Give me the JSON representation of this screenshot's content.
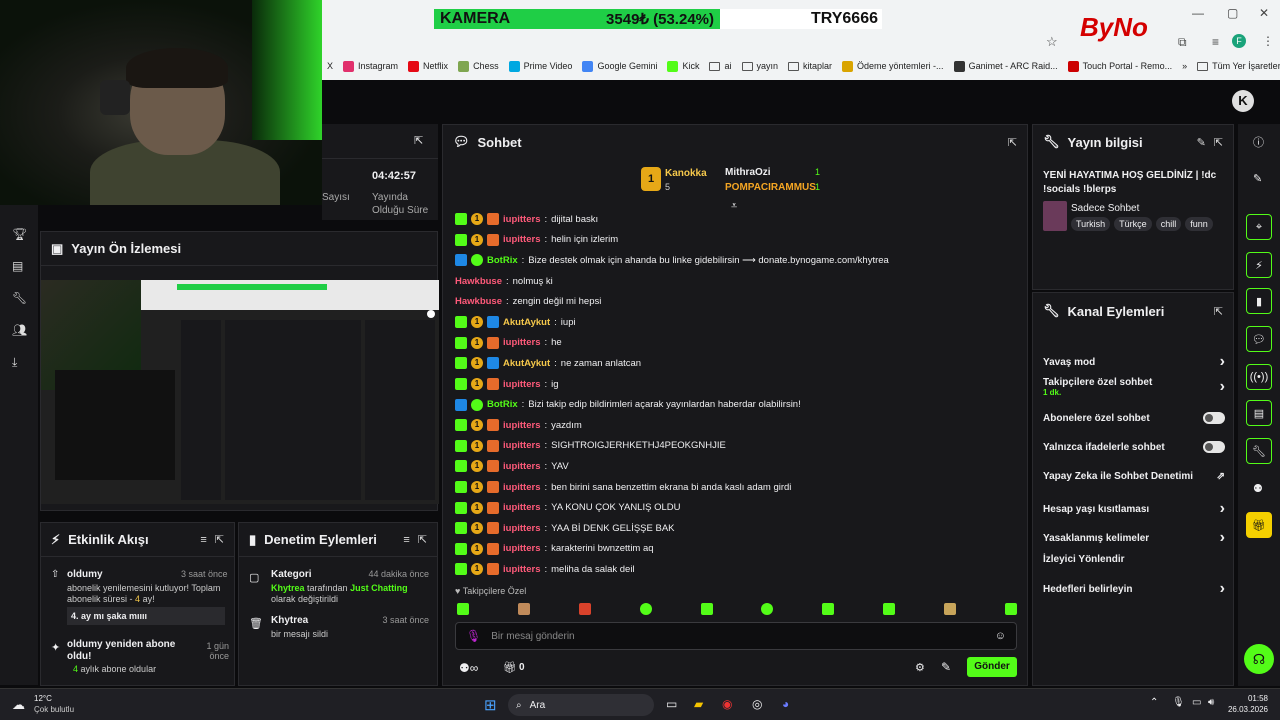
{
  "ticker": {
    "label": "KAMERA",
    "price": "3549₺ (53.24%)",
    "code": "TRY6666"
  },
  "logo": {
    "text": "ByNo"
  },
  "bookmarks": [
    "X",
    "Instagram",
    "Netflix",
    "Chess",
    "Prime Video",
    "Google Gemini",
    "Kick",
    "ai",
    "yayın",
    "kitaplar",
    "Ödeme yöntemleri -...",
    "Ganimet - ARC Raid...",
    "Touch Portal - Remo...",
    "»",
    "Tüm Yer İşaretleri"
  ],
  "stats": {
    "time": "04:42:57",
    "viewers_label": "Sayısı",
    "duration_label": "Yayında Olduğu Süre"
  },
  "preview": {
    "title": "Yayın Ön İzlemesi"
  },
  "chat": {
    "title": "Sohbet",
    "top": [
      {
        "rank": "1",
        "name": "Kanokka",
        "count": "5"
      },
      {
        "name": "MithraOzi",
        "count": "1"
      },
      {
        "name": "POMPACIRAMMUS",
        "count": "1"
      }
    ],
    "messages": [
      {
        "user": "iupitters",
        "text": "dijital baskı",
        "color": "pink",
        "badges": true
      },
      {
        "user": "iupitters",
        "text": "helin için izlerim",
        "color": "pink",
        "badges": true
      },
      {
        "user": "BotRix",
        "text": "Bize destek olmak için ahanda bu linke gidebilirsin ⟶ donate.bynogame.com/khytrea",
        "color": "bot",
        "badges": true
      },
      {
        "user": "Hawkbuse",
        "text": "nolmuş ki",
        "color": "pink",
        "badges": false
      },
      {
        "user": "Hawkbuse",
        "text": "zengin değil mi hepsi",
        "color": "pink",
        "badges": false
      },
      {
        "user": "AkutAykut",
        "text": "iupi",
        "color": "gold",
        "badges": true
      },
      {
        "user": "iupitters",
        "text": "he",
        "color": "pink",
        "badges": true
      },
      {
        "user": "AkutAykut",
        "text": "ne zaman anlatcan",
        "color": "gold",
        "badges": true
      },
      {
        "user": "iupitters",
        "text": "ig",
        "color": "pink",
        "badges": true
      },
      {
        "user": "BotRix",
        "text": "Bizi takip edip bildirimleri açarak yayınlardan haberdar olabilirsin!",
        "color": "bot",
        "badges": true
      },
      {
        "user": "iupitters",
        "text": "yazdım",
        "color": "pink",
        "badges": true
      },
      {
        "user": "iupitters",
        "text": "SIGHTROIGJERHKETHJ4PEOKGNHJIE",
        "color": "pink",
        "badges": true
      },
      {
        "user": "iupitters",
        "text": "YAV",
        "color": "pink",
        "badges": true
      },
      {
        "user": "iupitters",
        "text": "ben birini sana benzettim ekrana bi anda kaslı adam girdi",
        "color": "pink",
        "badges": true
      },
      {
        "user": "iupitters",
        "text": "YA KONU ÇOK YANLIŞ OLDU",
        "color": "pink",
        "badges": true
      },
      {
        "user": "iupitters",
        "text": "YAA Bİ DENK GELİŞŞE BAK",
        "color": "pink",
        "badges": true
      },
      {
        "user": "iupitters",
        "text": "karakterini bwnzettim aq",
        "color": "pink",
        "badges": true
      },
      {
        "user": "iupitters",
        "text": "meliha da salak deil",
        "color": "pink",
        "badges": true
      }
    ],
    "followers_only": "Takipçilere Özel",
    "placeholder": "Bir mesaj gönderin",
    "points": "0",
    "send": "Gönder"
  },
  "info": {
    "title": "Yayın bilgisi",
    "stream_title": "YENİ HAYATIMA HOŞ GELDİNİZ | !dc !socials !blerps",
    "category": "Sadece Sohbet",
    "tags": [
      "Turkish",
      "Türkçe",
      "chill",
      "funn"
    ]
  },
  "actions": {
    "title": "Kanal Eylemleri",
    "items": [
      {
        "label": "Yavaş mod",
        "kind": "arrow"
      },
      {
        "label": "Takipçilere özel sohbet",
        "sub": "1 dk.",
        "kind": "arrow"
      },
      {
        "label": "Abonelere özel sohbet",
        "kind": "toggle"
      },
      {
        "label": "Yalnızca ifadelerle sohbet",
        "kind": "toggle"
      },
      {
        "label": "Yapay Zeka ile Sohbet Denetimi",
        "kind": "ext"
      },
      {
        "label": "Hesap yaşı kısıtlaması",
        "kind": "arrow"
      },
      {
        "label": "Yasaklanmış kelimeler",
        "kind": "arrow"
      },
      {
        "label": "İzleyici Yönlendir",
        "kind": "none"
      },
      {
        "label": "Hedefleri belirleyin",
        "kind": "arrow"
      }
    ]
  },
  "activity": {
    "title": "Etkinlik Akışı",
    "e1_user": "oldumy",
    "e1_time": "3 saat önce",
    "e1_text": "abonelik yenilemesini kutluyor! Toplam abonelik süresi - ",
    "e1_months": "4",
    "e1_unit": " ay!",
    "e1_msg": "4. ay mı şaka mıııı",
    "e2_title": "oldumy yeniden abone oldu!",
    "e2_time": "1 gün önce",
    "e2_num": "4",
    "e2_text": " aylık abone oldular"
  },
  "moderation": {
    "title": "Denetim Eylemleri",
    "m1_title": "Kategori",
    "m1_time": "44 dakika önce",
    "m1_user": "Khytrea",
    "m1_mid": " tarafından ",
    "m1_cat": "Just Chatting",
    "m1_end": " olarak değiştirildi",
    "m2_title": "Khytrea",
    "m2_time": "3 saat önce",
    "m2_text": "bir mesajı sildi"
  },
  "taskbar": {
    "temp": "12°C",
    "weather": "Çok bulutlu",
    "search": "Ara",
    "time": "01:58",
    "date": "26.03.2026"
  },
  "colors": {
    "accent": "#53fc18",
    "panel": "#18181b",
    "bg": "#0b0b0d"
  }
}
